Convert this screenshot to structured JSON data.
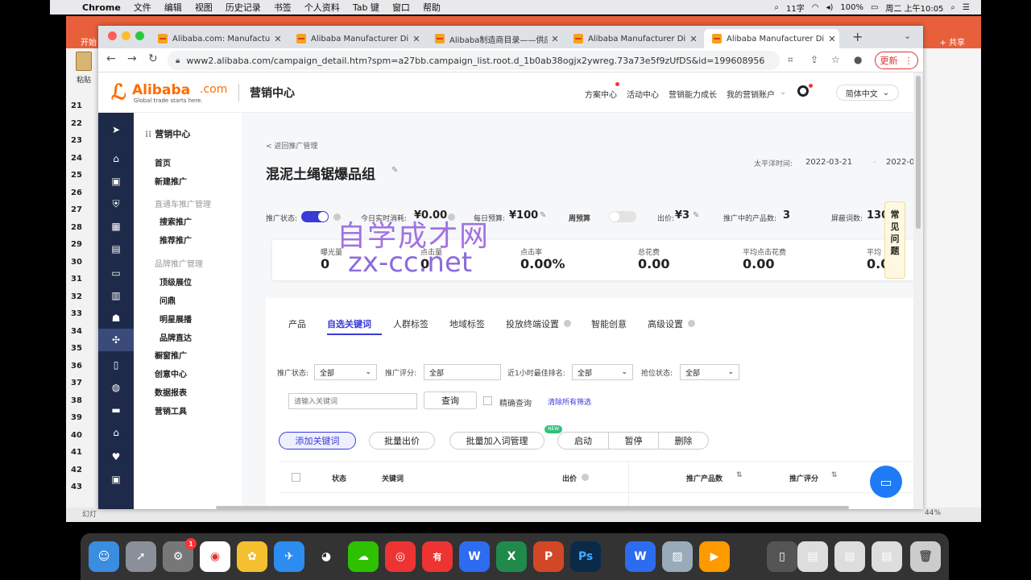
{
  "menubar": {
    "app": "Chrome",
    "items": [
      "文件",
      "编辑",
      "视图",
      "历史记录",
      "书签",
      "个人资料",
      "Tab 键",
      "窗口",
      "帮助"
    ],
    "status_text": "11字",
    "battery": "100%",
    "clock": "周二 上午10:05"
  },
  "bg_app": {
    "start_tab": "开始",
    "share": "+ 共享",
    "paste": "粘贴",
    "line_numbers": [
      "21",
      "22",
      "23",
      "24",
      "25",
      "26",
      "27",
      "28",
      "29",
      "30",
      "31",
      "32",
      "33",
      "34",
      "35",
      "36",
      "37",
      "38",
      "39",
      "40",
      "41",
      "42",
      "43"
    ],
    "status_left": "幻灯",
    "zoom": "44%"
  },
  "browser": {
    "tabs": [
      {
        "title": "Alibaba.com: Manufacture"
      },
      {
        "title": "Alibaba Manufacturer Direc"
      },
      {
        "title": "Alibaba制造商目录——供应"
      },
      {
        "title": "Alibaba Manufacturer Direc"
      },
      {
        "title": "Alibaba Manufacturer Direc"
      }
    ],
    "url": "www2.alibaba.com/campaign_detail.htm?spm=a27bb.campaign_list.root.d_1b0ab38ogjx2ywreg.73a73e5f9zUfDS&id=199608956",
    "update_label": "更新"
  },
  "header": {
    "logo_word": "Alibaba",
    "logo_com": ".com",
    "logo_slogan": "Global trade starts here.",
    "title": "营销中心",
    "nav": [
      "方案中心",
      "活动中心",
      "营销能力成长",
      "我的营销账户"
    ],
    "lang": "简体中文"
  },
  "submenu": {
    "title": "营销中心",
    "items": {
      "home": "首页",
      "new": "新建推广",
      "group1": "直通车推广管理",
      "search": "搜索推广",
      "recommend": "推荐推广",
      "group2": "品牌推广管理",
      "top": "顶级展位",
      "wending": "问鼎",
      "star": "明星展播",
      "brand": "品牌直达",
      "window": "橱窗推广",
      "creative": "创意中心",
      "report": "数据报表",
      "tools": "营销工具"
    }
  },
  "campaign": {
    "back": "< 返回推广管理",
    "title": "混泥土绳锯爆品组",
    "date_label": "太平洋时间:",
    "date_from": "2022-03-21",
    "date_to": "2022-0",
    "status_label": "推广状态:",
    "today_spend_label": "今日实时消耗:",
    "today_spend": "¥0.00",
    "daily_budget_label": "每日预算:",
    "daily_budget": "¥100",
    "weekly_budget_label": "周预算",
    "bid_label": "出价:",
    "bid": "¥3",
    "products_label": "推广中的产品数:",
    "products": "3",
    "blocked_label": "屏蔽词数:",
    "blocked": "130"
  },
  "stats": [
    {
      "label": "曝光量",
      "value": "0"
    },
    {
      "label": "点击量",
      "value": "0"
    },
    {
      "label": "点击率",
      "value": "0.00%"
    },
    {
      "label": "总花费",
      "value": "0.00"
    },
    {
      "label": "平均点击花费",
      "value": "0.00"
    },
    {
      "label": "平均",
      "value": "0.0"
    }
  ],
  "watermark": {
    "line1": "自学成才网",
    "line2": "zx-cc.net"
  },
  "tabs": [
    "产品",
    "自选关键词",
    "人群标签",
    "地域标签",
    "投放终端设置",
    "智能创意",
    "高级设置"
  ],
  "filters": {
    "status_label": "推广状态:",
    "status_value": "全部",
    "score_label": "推广评分:",
    "score_value": "全部",
    "rank_label": "近1小时最佳排名:",
    "rank_value": "全部",
    "grab_label": "抢位状态:",
    "grab_value": "全部",
    "keyword_placeholder": "请输入关键词",
    "query": "查询",
    "exact": "精确查询",
    "clear": "清除所有筛选"
  },
  "actions": {
    "add": "添加关键词",
    "bulk_bid": "批量出价",
    "bulk_add": "批量加入词管理",
    "new_badge": "NEW",
    "start": "启动",
    "pause": "暂停",
    "delete": "删除"
  },
  "table_headers": [
    "状态",
    "关键词",
    "出价",
    "推广产品数",
    "推广评分"
  ],
  "faq": "常见问题",
  "colors": {
    "brand": "#ff6a00",
    "accent": "#3a3ad6",
    "sidebar": "#1e2a4a"
  }
}
